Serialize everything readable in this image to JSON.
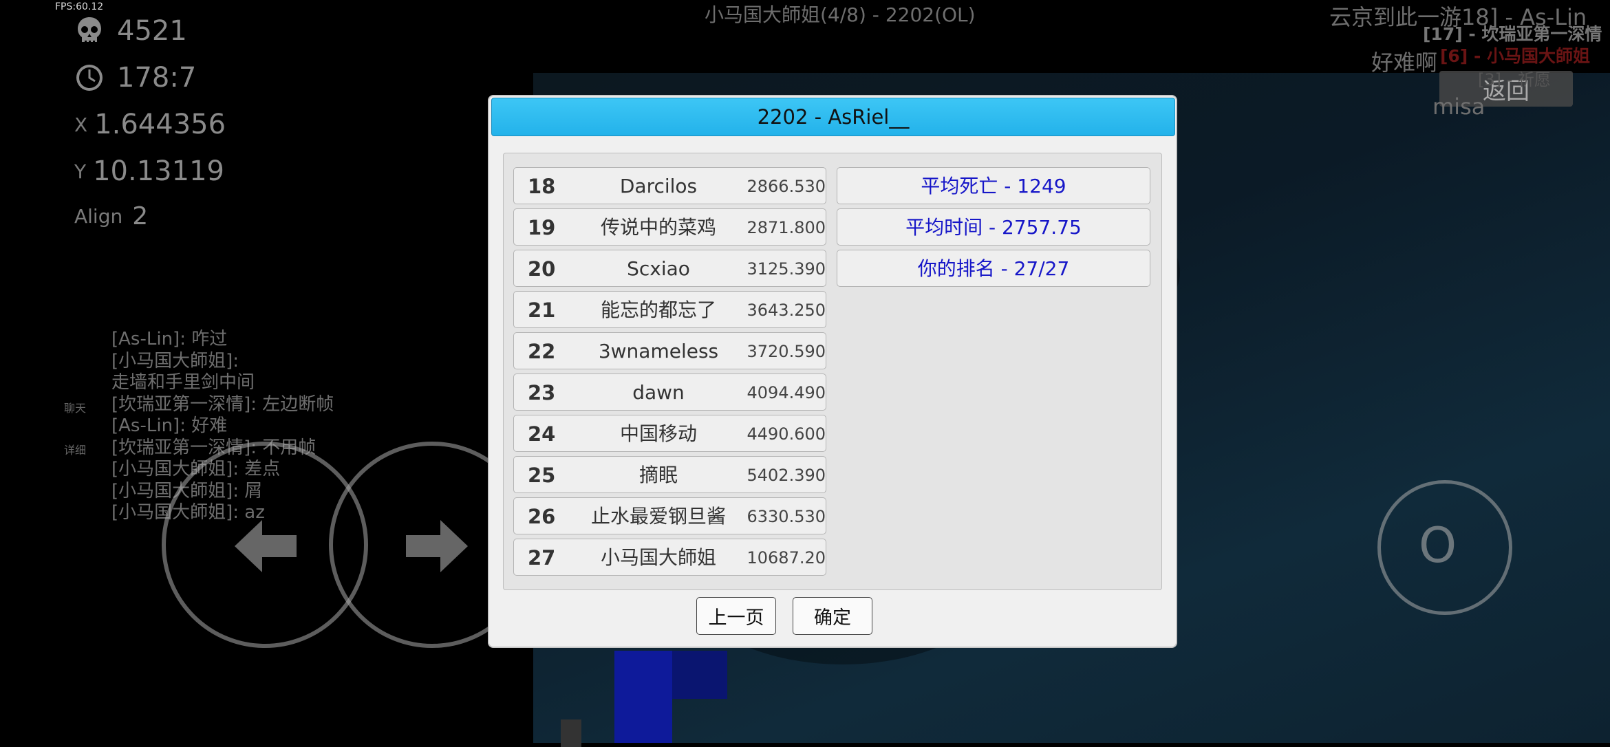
{
  "hud": {
    "fps": "FPS:60.12",
    "deaths": "4521",
    "time": "178:7",
    "x_label": "X",
    "x_value": "1.644356",
    "y_label": "Y",
    "y_value": "10.13119",
    "align_label": "Align",
    "align_value": "2"
  },
  "header": {
    "room_title": "小马国大師姐(4/8) - 2202(OL)"
  },
  "players": {
    "line1": "云京到此一游18] - As-Lin",
    "line2": "[17] - 坎瑞亚第一深情",
    "line3": "[6] - 小马国大師姐",
    "line4": "好难啊",
    "line5": "[3] - 祈愿",
    "line6": "misa",
    "back_label": "返回"
  },
  "chat": {
    "side_chat": "聊天",
    "side_detail": "详细",
    "lines": [
      "[As-Lin]: 咋过",
      "[小马国大師姐]:",
      "走墙和手里剑中间",
      "[坎瑞亚第一深情]: 左边断帧",
      "[As-Lin]: 好难",
      "[坎瑞亚第一深情]: 不用帧",
      "[小马国大師姐]: 差点",
      "[小马国大師姐]: 屑",
      "[小马国大師姐]: az"
    ]
  },
  "controls": {
    "jump_label": "O",
    "left_icon": "arrow-left-icon",
    "right_icon": "arrow-right-icon"
  },
  "dialog": {
    "title": "2202 - AsRiel__",
    "rankings": [
      {
        "rank": "18",
        "name": "Darcilos",
        "time": "2866.530"
      },
      {
        "rank": "19",
        "name": "传说中的菜鸡",
        "time": "2871.800"
      },
      {
        "rank": "20",
        "name": "Scxiao",
        "time": "3125.390"
      },
      {
        "rank": "21",
        "name": "能忘的都忘了",
        "time": "3643.250"
      },
      {
        "rank": "22",
        "name": "3wnameless",
        "time": "3720.590"
      },
      {
        "rank": "23",
        "name": "dawn",
        "time": "4094.490"
      },
      {
        "rank": "24",
        "name": "中国移动",
        "time": "4490.600"
      },
      {
        "rank": "25",
        "name": "摘眠",
        "time": "5402.390"
      },
      {
        "rank": "26",
        "name": "止水最爱钢旦酱",
        "time": "6330.530"
      },
      {
        "rank": "27",
        "name": "小马国大師姐",
        "time": "10687.20"
      }
    ],
    "stats": {
      "avg_deaths": "平均死亡 - 1249",
      "avg_time": "平均时间 - 2757.75",
      "your_rank": "你的排名 - 27/27"
    },
    "prev_page_label": "上一页",
    "confirm_label": "确定"
  },
  "colors": {
    "title_bar": "#23b2ea",
    "stat_text": "#1616c8",
    "highlight_player": "#6a1414"
  }
}
